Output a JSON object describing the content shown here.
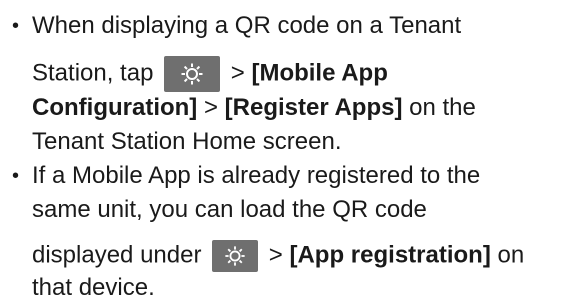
{
  "bullets": [
    {
      "line1": "When displaying a QR code on a Tenant",
      "line2_pre": "Station, tap",
      "line2_sep": ">",
      "line2_bold": "[Mobile App",
      "line3_bold_a": "Configuration]",
      "line3_sep": ">",
      "line3_bold_b": "[Register Apps]",
      "line3_post": "on the",
      "line4": "Tenant Station Home screen."
    },
    {
      "line1": "If a Mobile App is already registered to the",
      "line2": "same unit, you can load the QR code",
      "line3_pre": "displayed under",
      "line3_sep": ">",
      "line3_bold": "[App registration]",
      "line3_post": "on",
      "line4": "that device."
    }
  ],
  "bullet_glyph": "•",
  "icons": {
    "settings_icon": "gear-icon"
  },
  "colors": {
    "text": "#1a1a1a",
    "icon_bg": "#6f6f6f",
    "icon_fg": "#ffffff"
  }
}
